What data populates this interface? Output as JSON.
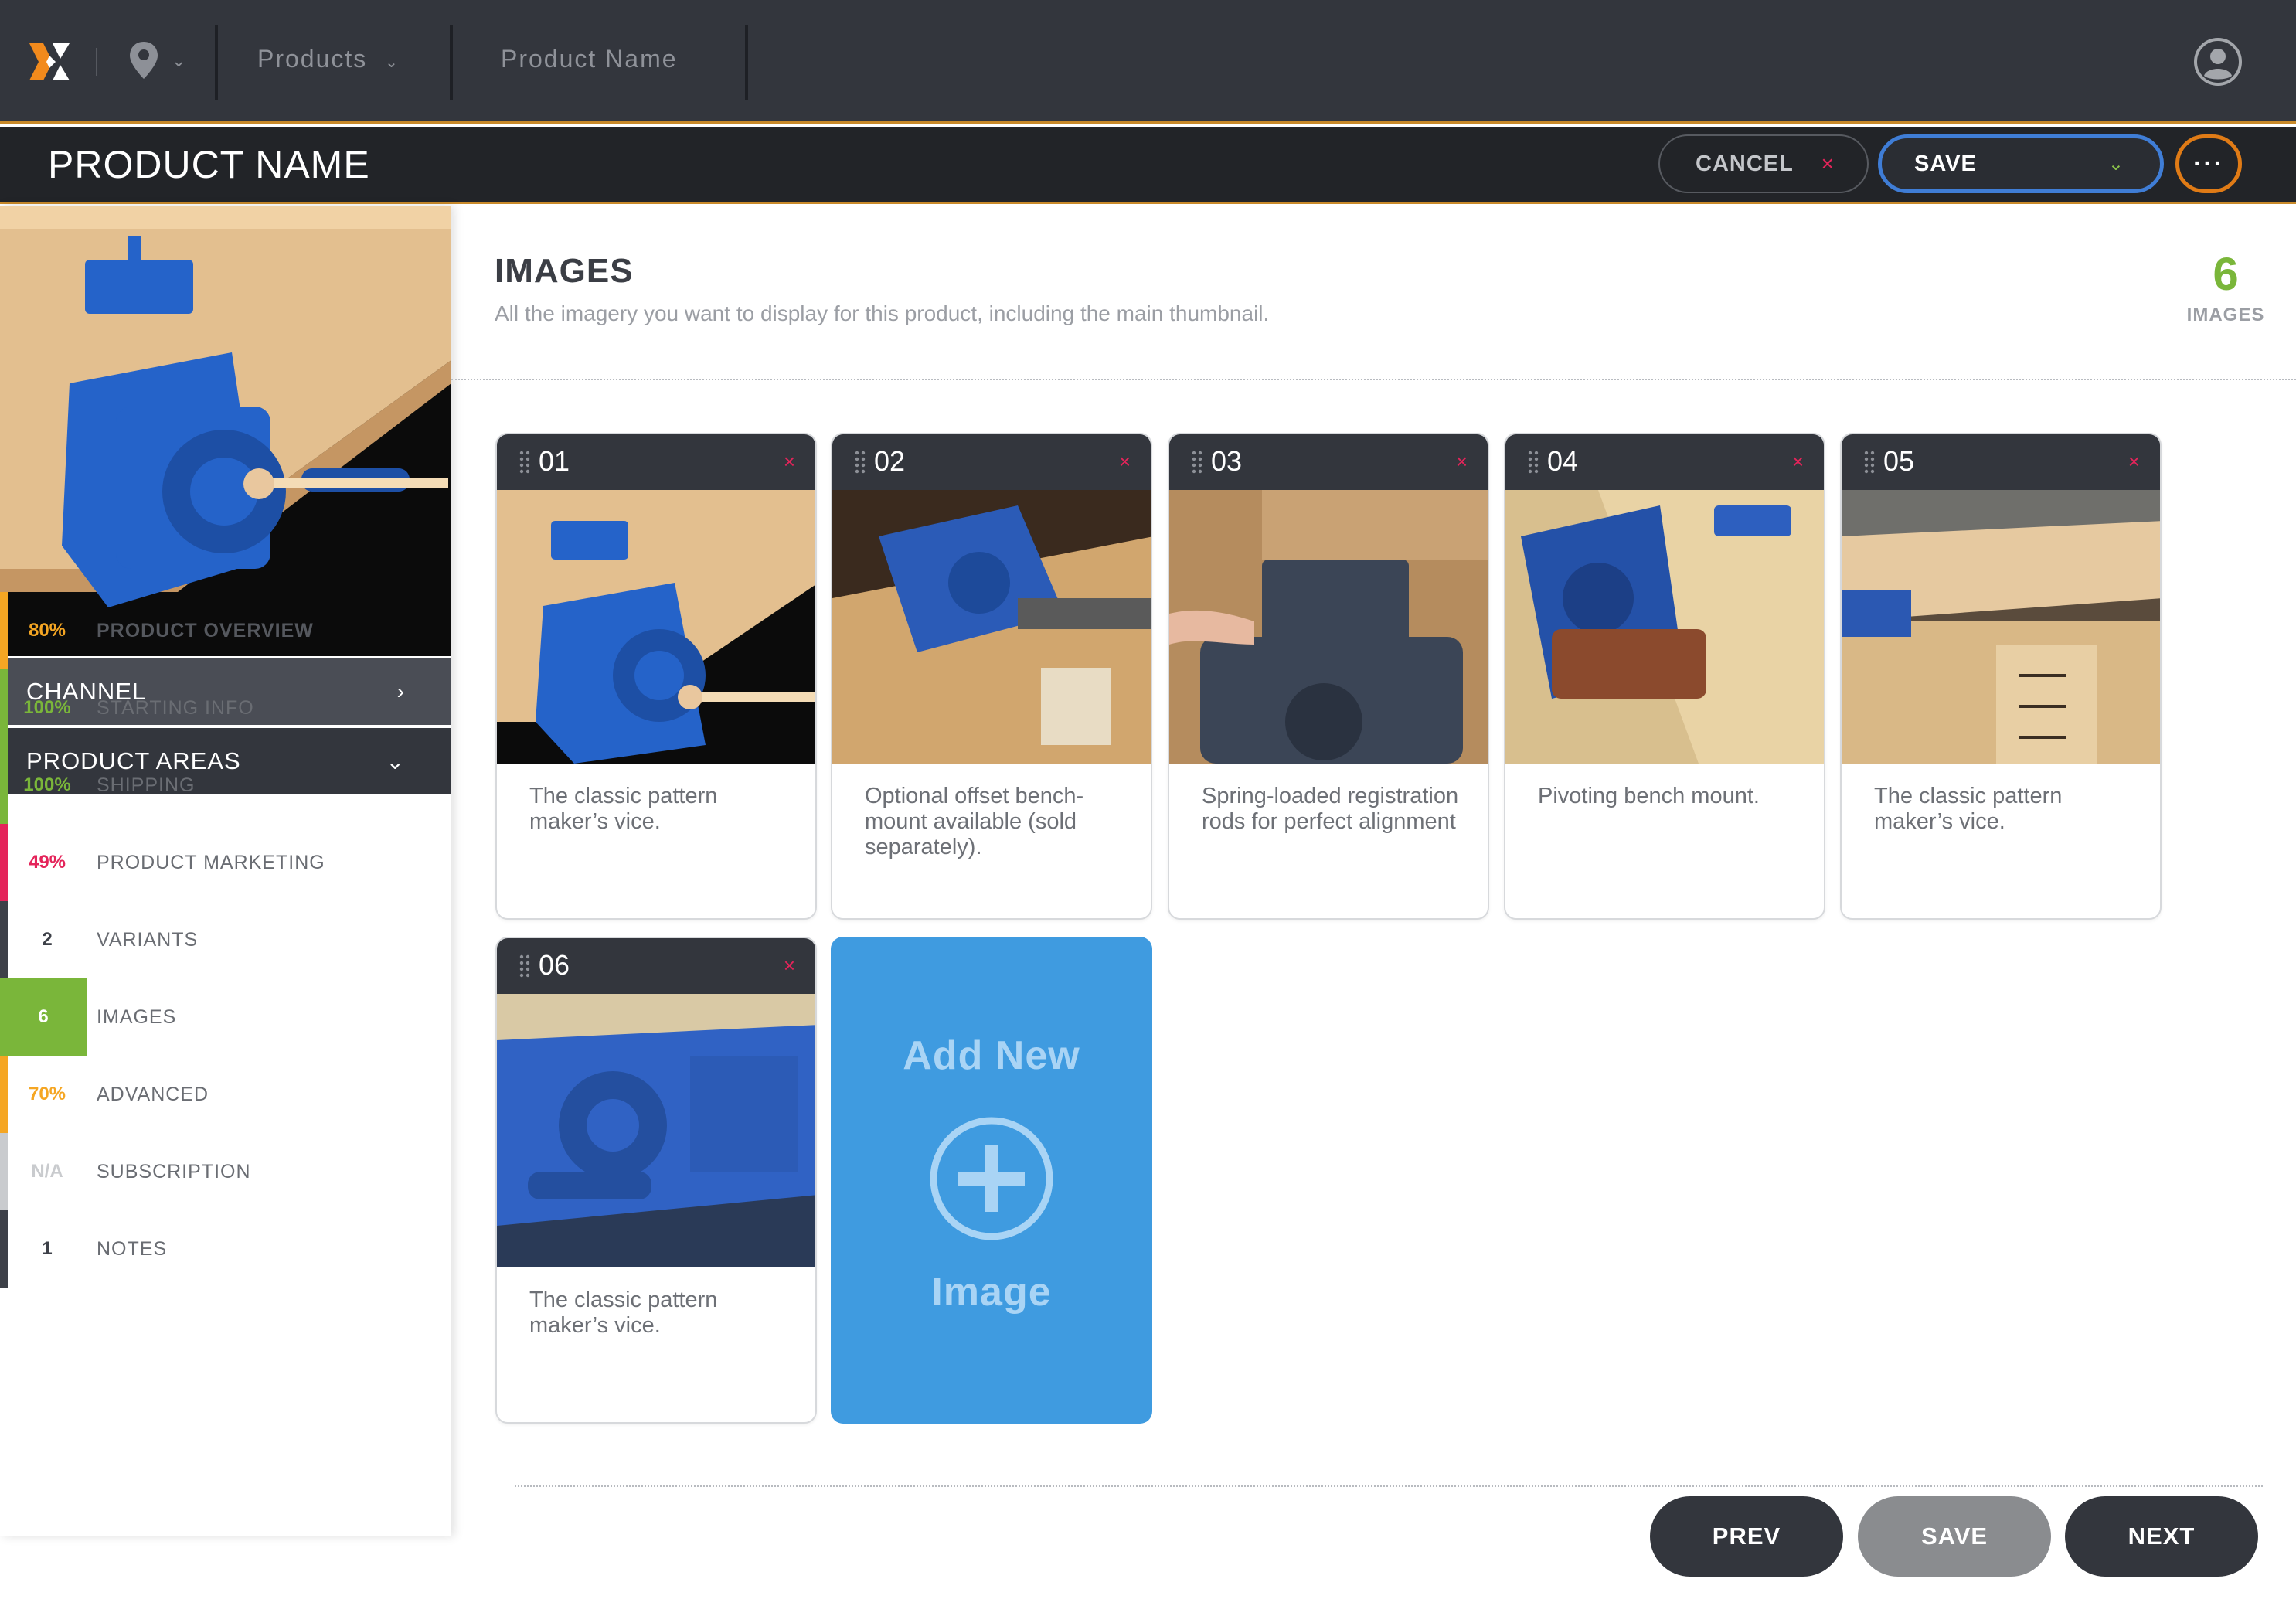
{
  "topbar": {
    "products_label": "Products",
    "breadcrumb_current": "Product Name"
  },
  "header": {
    "title": "PRODUCT NAME",
    "cancel_label": "CANCEL",
    "save_label": "SAVE",
    "more_label": "···"
  },
  "sidebar": {
    "channel_label": "CHANNEL",
    "areas_label": "PRODUCT AREAS",
    "areas": [
      {
        "value": "80%",
        "label": "PRODUCT OVERVIEW",
        "color": "#f5a623",
        "active": false
      },
      {
        "value": "100%",
        "label": "STARTING INFO",
        "color": "#7ab63a",
        "active": false
      },
      {
        "value": "100%",
        "label": "SHIPPING",
        "color": "#7ab63a",
        "active": false
      },
      {
        "value": "49%",
        "label": "PRODUCT MARKETING",
        "color": "#e4245a",
        "active": false
      },
      {
        "value": "2",
        "label": "VARIANTS",
        "color": "#3d4048",
        "active": false
      },
      {
        "value": "6",
        "label": "IMAGES",
        "color": "#7ab63a",
        "active": true
      },
      {
        "value": "70%",
        "label": "ADVANCED",
        "color": "#f5a623",
        "active": false
      },
      {
        "value": "N/A",
        "label": "SUBSCRIPTION",
        "color": "#c9cbce",
        "active": false
      },
      {
        "value": "1",
        "label": "NOTES",
        "color": "#3d4048",
        "active": false
      }
    ]
  },
  "main": {
    "title": "IMAGES",
    "description": "All the imagery you want to display for this product, including the main thumbnail.",
    "count": "6",
    "count_label": "IMAGES",
    "images": [
      {
        "number": "01",
        "caption": "The classic pattern maker’s vice."
      },
      {
        "number": "02",
        "caption": "Optional offset bench-mount available (sold separately)."
      },
      {
        "number": "03",
        "caption": "Spring-loaded registration rods for perfect alignment"
      },
      {
        "number": "04",
        "caption": "Pivoting bench mount."
      },
      {
        "number": "05",
        "caption": "The classic pattern maker’s vice."
      },
      {
        "number": "06",
        "caption": "The classic pattern maker’s vice."
      }
    ],
    "remove_icon": "×",
    "add_new_top": "Add New",
    "add_new_bottom": "Image"
  },
  "footer": {
    "prev_label": "PREV",
    "save_label": "SAVE",
    "next_label": "NEXT"
  },
  "colors": {
    "accent_orange": "#e07b16",
    "save_blue": "#3f7dd6",
    "add_card_blue": "#3f9be0",
    "complete_green": "#7ab63a",
    "warning_orange": "#f5a623",
    "alert_red": "#e4245a"
  }
}
